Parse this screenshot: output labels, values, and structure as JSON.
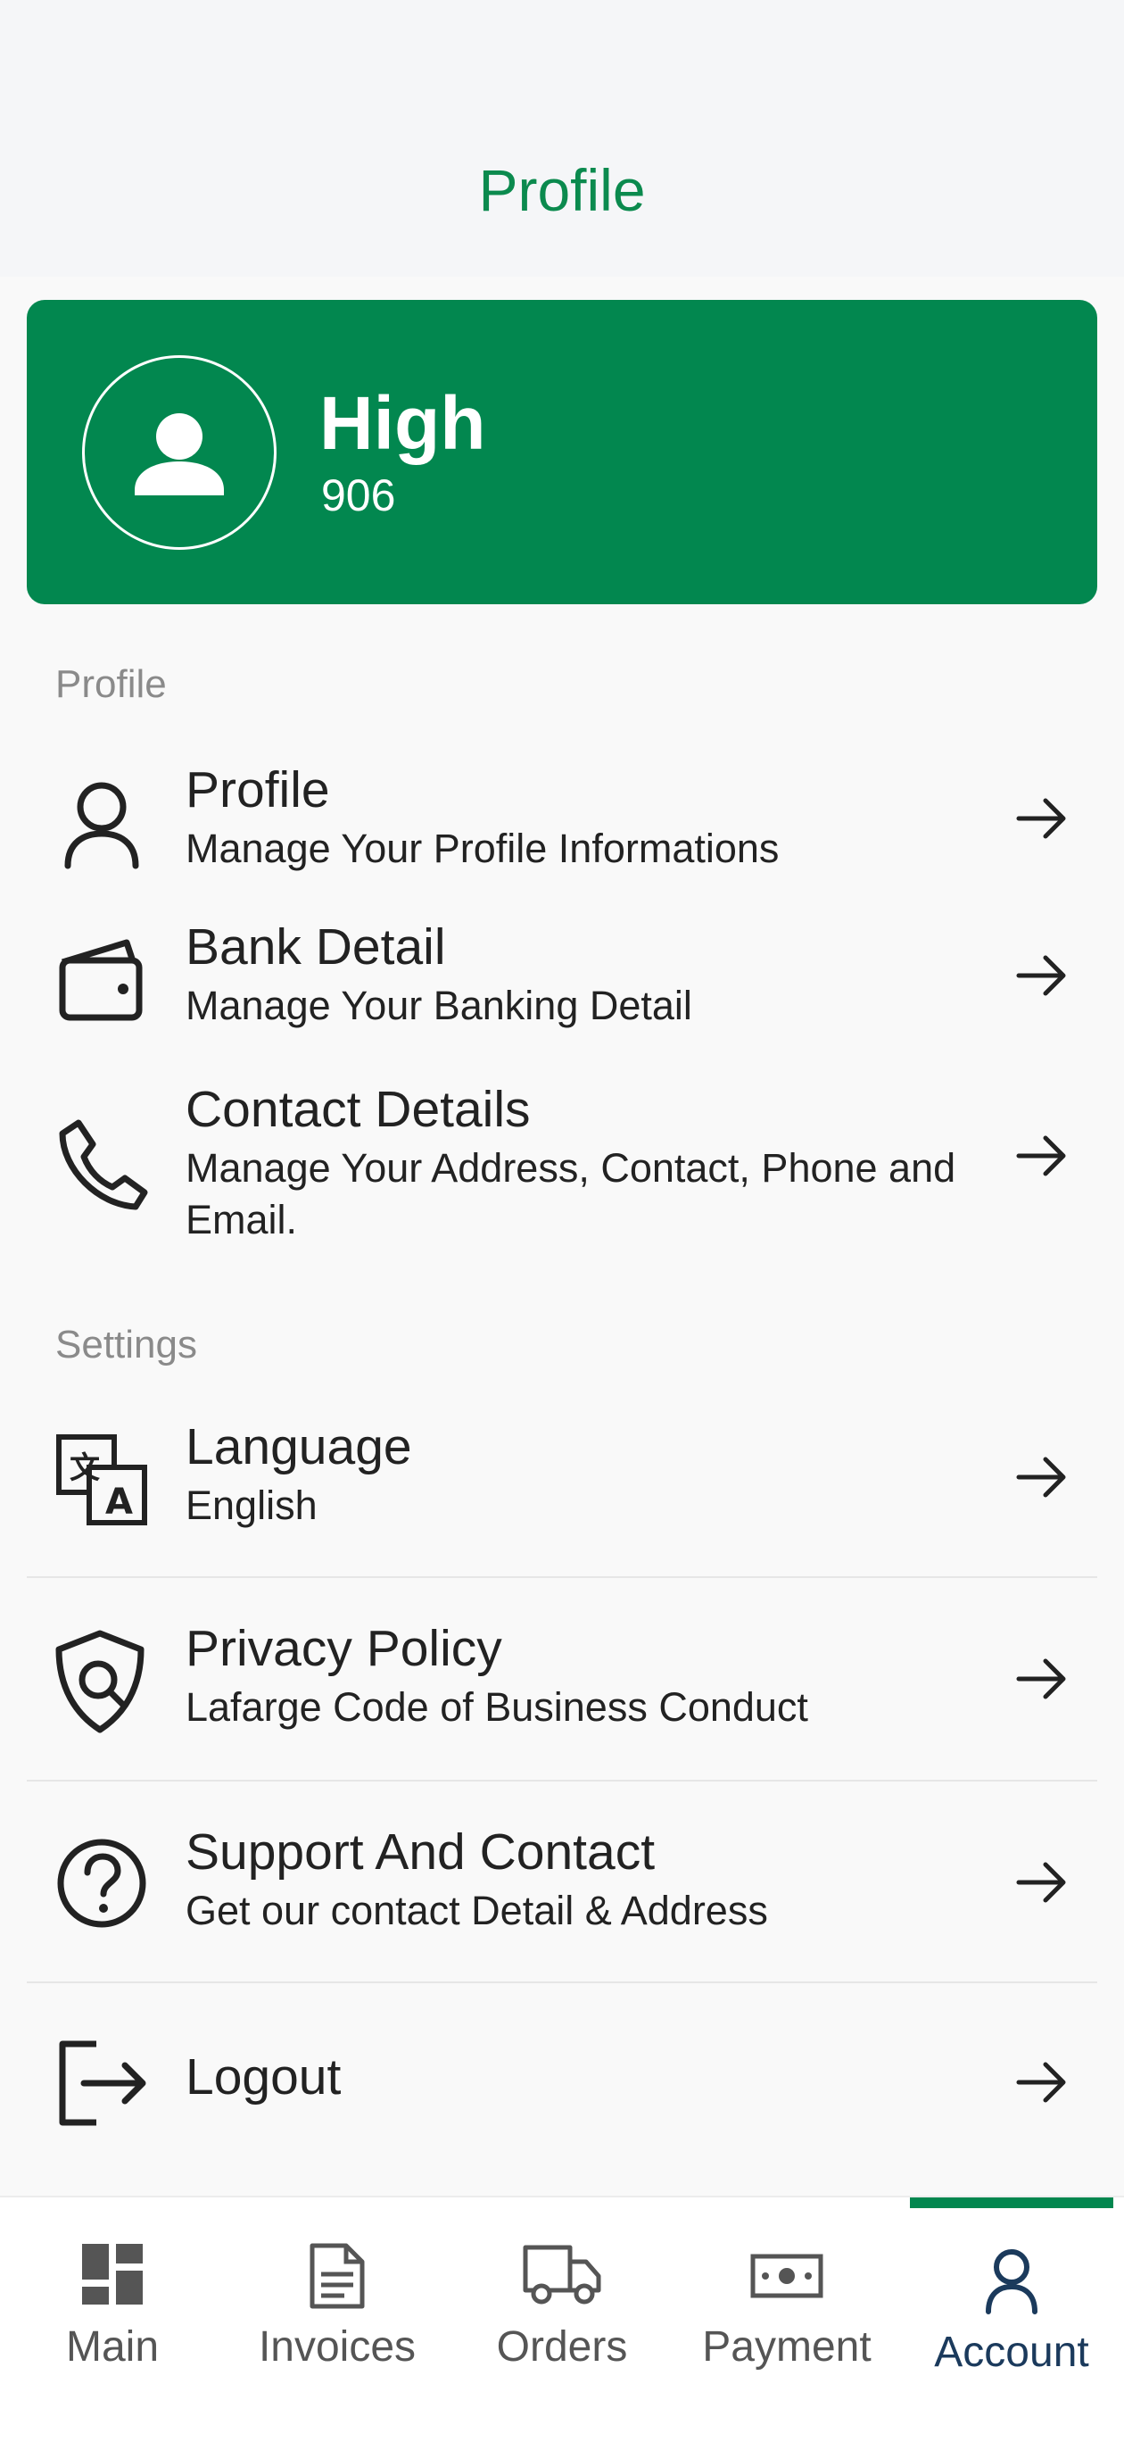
{
  "header": {
    "title": "Profile"
  },
  "user": {
    "name": "High",
    "id": "906"
  },
  "sections": {
    "profile_label": "Profile",
    "settings_label": "Settings"
  },
  "profile_items": [
    {
      "title": "Profile",
      "subtitle": "Manage Your Profile Informations",
      "icon": "person-icon"
    },
    {
      "title": "Bank Detail",
      "subtitle": "Manage Your Banking Detail",
      "icon": "wallet-icon"
    },
    {
      "title": "Contact Details",
      "subtitle": "Manage Your Address, Contact, Phone and Email.",
      "icon": "phone-icon"
    }
  ],
  "settings_items": [
    {
      "title": "Language",
      "subtitle": "English",
      "icon": "translate-icon"
    },
    {
      "title": "Privacy Policy",
      "subtitle": "Lafarge Code of Business Conduct",
      "icon": "shield-search-icon"
    },
    {
      "title": "Support And Contact",
      "subtitle": "Get our contact Detail & Address",
      "icon": "help-circle-icon"
    },
    {
      "title": "Logout",
      "subtitle": "",
      "icon": "logout-icon"
    }
  ],
  "nav": [
    {
      "label": "Main",
      "icon": "dashboard-icon"
    },
    {
      "label": "Invoices",
      "icon": "invoice-icon"
    },
    {
      "label": "Orders",
      "icon": "truck-icon"
    },
    {
      "label": "Payment",
      "icon": "cash-icon"
    },
    {
      "label": "Account",
      "icon": "account-icon",
      "active": true
    }
  ],
  "colors": {
    "brand": "#02874f",
    "title_green": "#0b8a4e",
    "active_nav": "#1b3a5c"
  }
}
